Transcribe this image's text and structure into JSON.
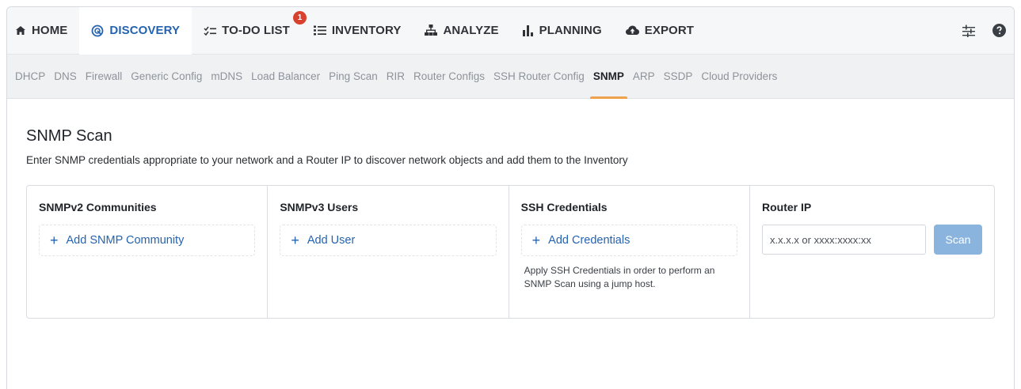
{
  "topnav": {
    "items": [
      {
        "label": "HOME",
        "icon": "home-icon"
      },
      {
        "label": "DISCOVERY",
        "icon": "radar-icon",
        "active": true
      },
      {
        "label": "TO-DO LIST",
        "icon": "checklist-icon",
        "badge": "1"
      },
      {
        "label": "INVENTORY",
        "icon": "list-icon"
      },
      {
        "label": "ANALYZE",
        "icon": "network-icon"
      },
      {
        "label": "PLANNING",
        "icon": "bar-chart-icon"
      },
      {
        "label": "EXPORT",
        "icon": "cloud-upload-icon"
      }
    ],
    "right_icons": [
      "settings-sliders-icon",
      "help-icon"
    ]
  },
  "subnav": {
    "items": [
      "DHCP",
      "DNS",
      "Firewall",
      "Generic Config",
      "mDNS",
      "Load Balancer",
      "Ping Scan",
      "RIR",
      "Router Configs",
      "SSH Router Config",
      "SNMP",
      "ARP",
      "SSDP",
      "Cloud Providers"
    ],
    "active": "SNMP"
  },
  "main": {
    "title": "SNMP Scan",
    "description": "Enter SNMP credentials appropriate to your network and a Router IP to discover network objects and add them to the Inventory",
    "cards": {
      "snmpv2": {
        "title": "SNMPv2 Communities",
        "add_label": "Add SNMP Community"
      },
      "snmpv3": {
        "title": "SNMPv3 Users",
        "add_label": "Add User"
      },
      "ssh": {
        "title": "SSH Credentials",
        "add_label": "Add Credentials",
        "help": "Apply SSH Credentials in order to perform an SNMP Scan using a jump host."
      },
      "router": {
        "title": "Router IP",
        "placeholder": "x.x.x.x or xxxx:xxxx:xx",
        "value": "",
        "scan_label": "Scan"
      }
    }
  },
  "colors": {
    "accent": "#2563b0",
    "badge": "#d9412f",
    "active_underline": "#f0a14e",
    "scan_button": "#8ab4de"
  }
}
